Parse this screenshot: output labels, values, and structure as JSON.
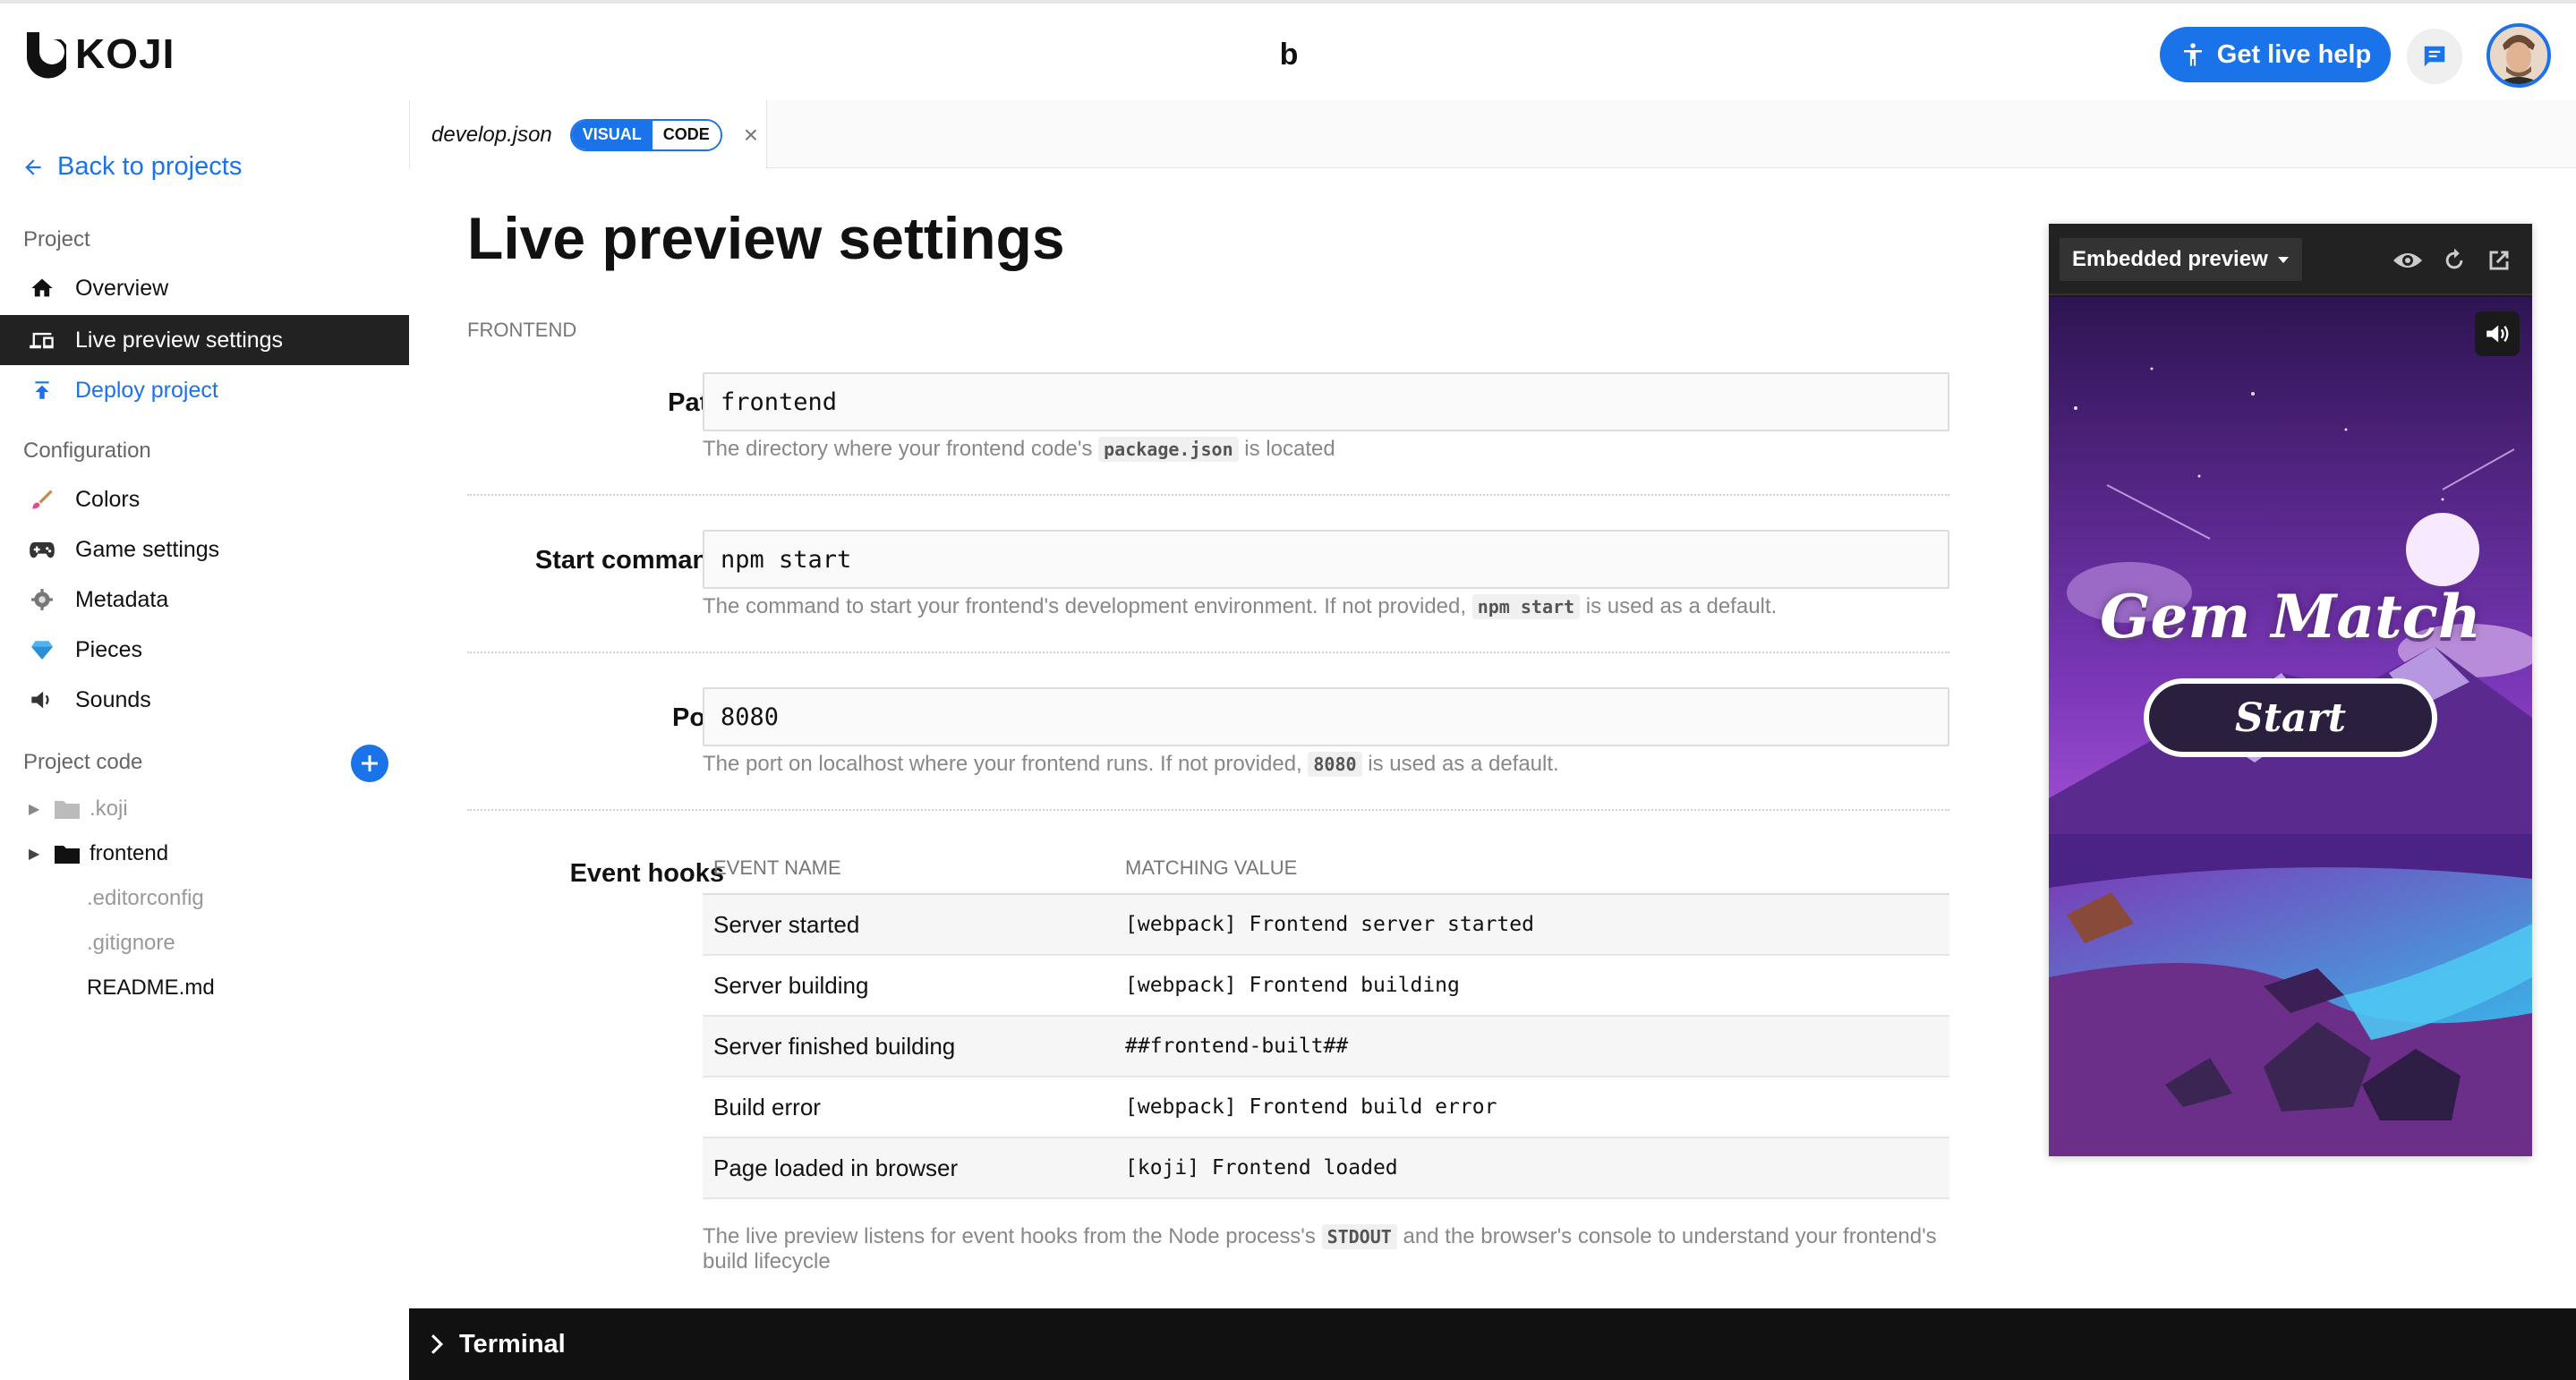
{
  "header": {
    "logo_text": "KOJI",
    "project_name": "b",
    "live_help_label": "Get live help"
  },
  "sidebar": {
    "back_label": "Back to projects",
    "project_section": "Project",
    "project_items": [
      {
        "label": "Overview",
        "icon": "home-icon",
        "active": false
      },
      {
        "label": "Live preview settings",
        "icon": "devices-icon",
        "active": true
      },
      {
        "label": "Deploy project",
        "icon": "publish-icon",
        "active": false
      }
    ],
    "config_section": "Configuration",
    "config_items": [
      {
        "label": "Colors",
        "icon": "paint-brush-icon"
      },
      {
        "label": "Game settings",
        "icon": "game-controller-icon"
      },
      {
        "label": "Metadata",
        "icon": "gear-icon"
      },
      {
        "label": "Pieces",
        "icon": "gem-icon"
      },
      {
        "label": "Sounds",
        "icon": "speaker-icon"
      }
    ],
    "code_section": "Project code",
    "tree": [
      {
        "label": ".koji",
        "type": "folder"
      },
      {
        "label": "frontend",
        "type": "folder"
      },
      {
        "label": ".editorconfig",
        "type": "file"
      },
      {
        "label": ".gitignore",
        "type": "file"
      },
      {
        "label": "README.md",
        "type": "file"
      }
    ]
  },
  "tab": {
    "file_name": "develop.json",
    "mode_visual": "VISUAL",
    "mode_code": "CODE"
  },
  "main": {
    "title": "Live preview settings",
    "section": "FRONTEND",
    "path": {
      "label": "Path",
      "value": "frontend",
      "help_prefix": "The directory where your frontend code's ",
      "help_code": "package.json",
      "help_suffix": " is located"
    },
    "start": {
      "label": "Start command",
      "value": "npm start",
      "help_prefix": "The command to start your frontend's development environment. If not provided, ",
      "help_code": "npm start",
      "help_suffix": " is used as a default."
    },
    "port": {
      "label": "Port",
      "value": "8080",
      "help_prefix": "The port on localhost where your frontend runs. If not provided, ",
      "help_code": "8080",
      "help_suffix": " is used as a default."
    },
    "hooks": {
      "label": "Event hooks",
      "col1": "EVENT NAME",
      "col2": "MATCHING VALUE",
      "rows": [
        {
          "name": "Server started",
          "value": "[webpack] Frontend server started"
        },
        {
          "name": "Server building",
          "value": "[webpack] Frontend building"
        },
        {
          "name": "Server finished building",
          "value": "##frontend-built##"
        },
        {
          "name": "Build error",
          "value": "[webpack] Frontend build error"
        },
        {
          "name": "Page loaded in browser",
          "value": "[koji] Frontend loaded"
        }
      ],
      "footer_prefix": "The live preview listens for event hooks from the Node process's ",
      "footer_code": "STDOUT",
      "footer_suffix": " and the browser's console to understand your frontend's build lifecycle"
    }
  },
  "preview": {
    "mode_label": "Embedded preview",
    "game_title": "Gem Match",
    "start_label": "Start"
  },
  "terminal": {
    "label": "Terminal"
  },
  "colors": {
    "accent": "#1a73e8",
    "active_nav": "#222222",
    "terminal_bg": "#111111"
  }
}
